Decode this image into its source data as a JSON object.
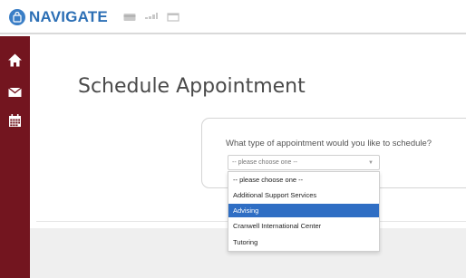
{
  "header": {
    "brand": "NAVIGATE",
    "icons": [
      "navigate-logo-icon",
      "credit-card-icon",
      "signal-bars-icon",
      "window-icon"
    ]
  },
  "sidebar": {
    "items": [
      {
        "icon": "home-icon"
      },
      {
        "icon": "envelope-icon"
      },
      {
        "icon": "calendar-icon"
      }
    ]
  },
  "main": {
    "title": "Schedule Appointment",
    "question": "What type of appointment would you like to schedule?",
    "select": {
      "value": "-- please choose one --",
      "options": [
        "-- please choose one --",
        "Additional Support Services",
        "Advising",
        "Cranwell International Center",
        "Tutoring"
      ],
      "highlighted": "Advising"
    }
  },
  "colors": {
    "brand": "#2c6fb5",
    "sidebar": "#73151f",
    "highlight": "#2f6ec4"
  }
}
